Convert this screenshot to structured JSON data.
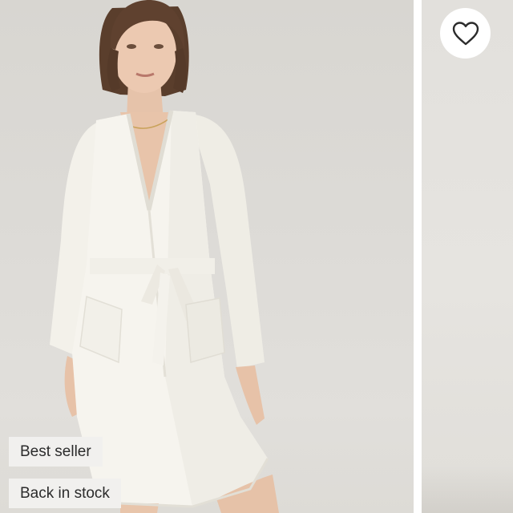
{
  "product_card": {
    "favorite": {
      "icon": "heart-outline-icon",
      "color": "#2b2b2b"
    },
    "badges": [
      {
        "label": "Best seller"
      },
      {
        "label": "Back in stock"
      }
    ],
    "colors": {
      "backdrop": "#dcdad6",
      "robe": "#f6f4ee",
      "badge_bg": "#f1f0ee",
      "badge_text": "#2b2b2b"
    }
  }
}
